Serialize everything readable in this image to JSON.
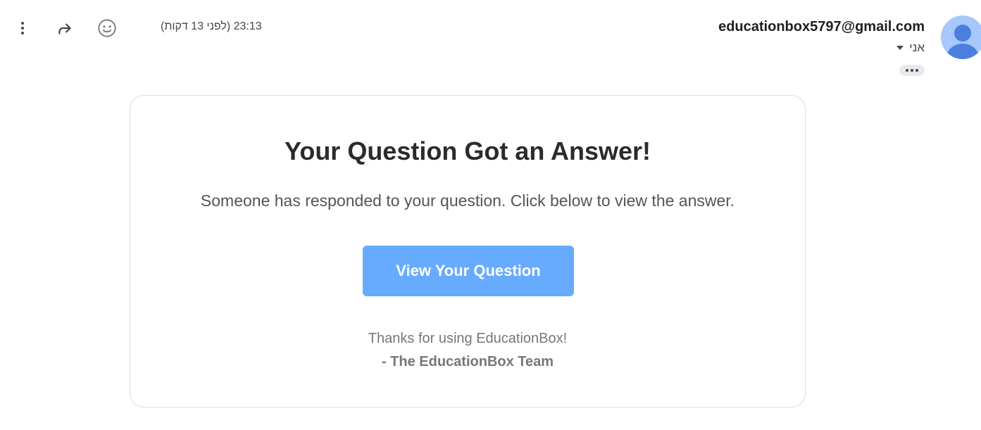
{
  "header": {
    "timestamp": "23:13 (לפני 13 דקות)",
    "sender_email": "educationbox5797@gmail.com",
    "recipient_label": "אני",
    "icons": [
      "more-vert-icon",
      "forward-icon",
      "emoji-icon",
      "avatar-icon",
      "ellipsis-icon"
    ]
  },
  "email_body": {
    "title": "Your Question Got an Answer!",
    "message": "Someone has responded to your question. Click below to view the answer.",
    "cta_label": "View Your Question",
    "thanks": "Thanks for using EducationBox!",
    "signature": "- The EducationBox Team"
  },
  "colors": {
    "cta_background": "#66abfe",
    "avatar_background": "#a8c7fa",
    "avatar_figure": "#4a7fe0"
  }
}
